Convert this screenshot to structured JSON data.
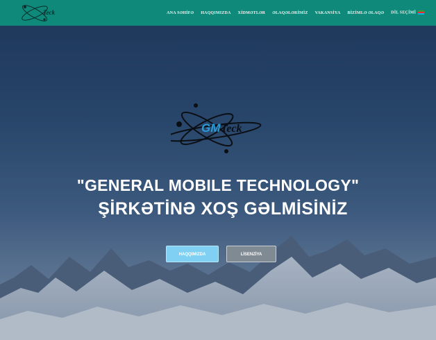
{
  "nav": {
    "logo_text": "Teck",
    "links": [
      "ANA SƏHİFƏ",
      "HAQQIMIZDA",
      "XİDMƏTLƏR",
      "ƏLAQƏLƏRİMİZ",
      "VAKANSİYA",
      "BİZİMLƏ ƏLAQƏ",
      "DİL SEÇİMİ"
    ],
    "flag_icon": "azerbaijan-flag-icon"
  },
  "hero": {
    "logo_text_gm": "GM",
    "logo_text_teck": "Teck",
    "title_line1": "\"GENERAL MOBILE TECHNOLOGY\"",
    "title_line2": "ŞİRKƏTİNƏ XOŞ GƏLMİSİNİZ",
    "button_about": "HAQQIMIZDA",
    "button_license": "LİSENZİYA"
  },
  "colors": {
    "navbar": "#0f8a7a",
    "button_about": "#7fd0f3",
    "button_license": "#7f8a93"
  }
}
